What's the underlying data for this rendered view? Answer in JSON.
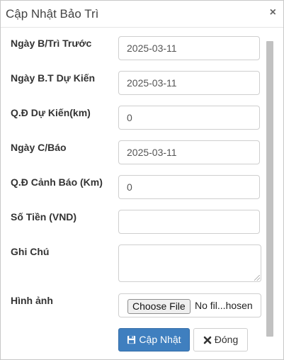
{
  "dialog": {
    "title": "Cập Nhật Bảo Trì",
    "close_symbol": "×"
  },
  "form": {
    "fields": [
      {
        "label": "Ngày B/Trì Trước",
        "value": "2025-03-11",
        "placeholder": ""
      },
      {
        "label": "Ngày B.T Dự Kiến",
        "value": "2025-03-11",
        "placeholder": ""
      },
      {
        "label": "Q.Đ Dự Kiến(km)",
        "value": "0",
        "placeholder": ""
      },
      {
        "label": "Ngày C/Báo",
        "value": "2025-03-11",
        "placeholder": ""
      },
      {
        "label": "Q.Đ Cảnh Báo (Km)",
        "value": "0",
        "placeholder": ""
      },
      {
        "label": "Số Tiền (VND)",
        "value": "",
        "placeholder": ""
      }
    ],
    "note": {
      "label": "Ghi Chú",
      "value": ""
    },
    "image": {
      "label": "Hình ảnh",
      "button_label": "Choose File",
      "file_text": "No fil...hosen"
    }
  },
  "actions": {
    "update_label": "Cập Nhật",
    "close_label": "Đóng",
    "update_icon": "save-icon",
    "close_icon": "close-icon"
  },
  "colors": {
    "primary": "#3f7fbf",
    "border": "#cfcfcf"
  }
}
